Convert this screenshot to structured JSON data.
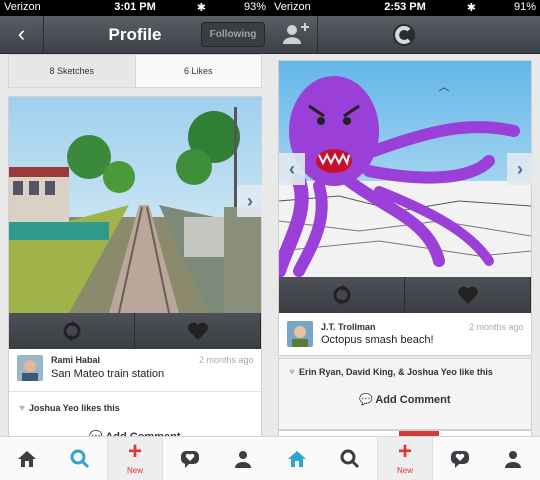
{
  "colors": {
    "accent": "#2fa4cf",
    "new_red": "#e5322d",
    "nav": "#45484e"
  },
  "left": {
    "status": {
      "carrier": "Verizon",
      "time": "3:01 PM",
      "battery": "93%"
    },
    "nav": {
      "title": "Profile",
      "following": "Following"
    },
    "tabs": [
      {
        "label": "8 Sketches"
      },
      {
        "label": "6 Likes"
      }
    ],
    "post": {
      "author": "Rami Habal",
      "ago": "2 months ago",
      "caption": "San Mateo train station",
      "likes": "Joshua Yeo likes this",
      "add_comment": "Add Comment"
    },
    "tabbar": {
      "new_label": "New",
      "active": "search"
    }
  },
  "right": {
    "status": {
      "carrier": "Verizon",
      "time": "2:53 PM",
      "battery": "91%"
    },
    "post": {
      "author": "J.T. Trollman",
      "ago": "2 months ago",
      "caption": "Octopus smash beach!",
      "likes": "Erin Ryan, David King, & Joshua Yeo like this",
      "add_comment": "Add Comment"
    },
    "tabbar": {
      "new_label": "New",
      "active": "home"
    }
  }
}
